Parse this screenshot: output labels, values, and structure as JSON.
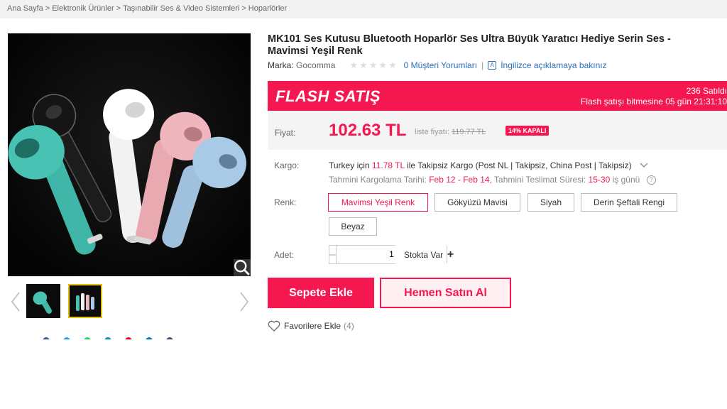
{
  "breadcrumb": [
    "Ana Sayfa",
    "Elektronik Ürünler",
    "Taşınabilir Ses & Video Sistemleri",
    "Hoparlörler"
  ],
  "breadcrumb_separator": ">",
  "product": {
    "title": "MK101 Ses Kutusu Bluetooth Hoparlör Ses Ultra Büyük Yaratıcı Hediye Serin Ses - Mavimsi Yeşil Renk",
    "brand_label": "Marka:",
    "brand": "Gocomma",
    "stars": "★★★★★",
    "reviews": "0 Müşteri Yorumları",
    "translate_link": "İngilizce açıklamaya bakınız"
  },
  "flash": {
    "title": "FLASH SATIŞ",
    "sold": "236 Satıldı",
    "timer": "Flash şatışı bitmesine 05 gün 21:31:10"
  },
  "price": {
    "label": "Fiyat:",
    "value": "102.63 TL",
    "list_label": "liste fiyatı:",
    "list_value": "119.77 TL",
    "discount": "14% KAPALI"
  },
  "shipping": {
    "label": "Kargo:",
    "prefix": "Turkey için",
    "cost": "11.78 TL",
    "suffix": "ile Takipsiz Kargo (Post NL | Takipsiz, China Post | Takipsiz)",
    "date_label": "Tahmini Kargolama Tarihi:",
    "date": "Feb 12 - Feb 14,",
    "delivery_label": "Tahmini Teslimat Süresi:",
    "delivery": "15-30",
    "delivery_unit": "iş günü"
  },
  "color": {
    "label": "Renk:",
    "options": [
      "Mavimsi Yeşil Renk",
      "Gökyüzü Mavisi",
      "Siyah",
      "Derin Şeftali Rengi",
      "Beyaz"
    ],
    "selected": "Mavimsi Yeşil Renk"
  },
  "quantity": {
    "label": "Adet:",
    "value": "1",
    "minus": "–",
    "plus": "+",
    "stock": "Stokta Var"
  },
  "actions": {
    "add_to_cart": "Sepete Ekle",
    "buy_now": "Hemen Satın Al",
    "favorite": "Favorilere Ekle",
    "favorite_count": "(4)"
  },
  "colors": {
    "accent": "#f51850",
    "link": "#2a6ebb",
    "thumb_selected_border": "#e5c20b"
  },
  "icons": [
    "zoom-icon",
    "chevron-left-icon",
    "chevron-right-icon",
    "translate-icon",
    "chevron-down-icon",
    "help-icon",
    "heart-icon"
  ]
}
